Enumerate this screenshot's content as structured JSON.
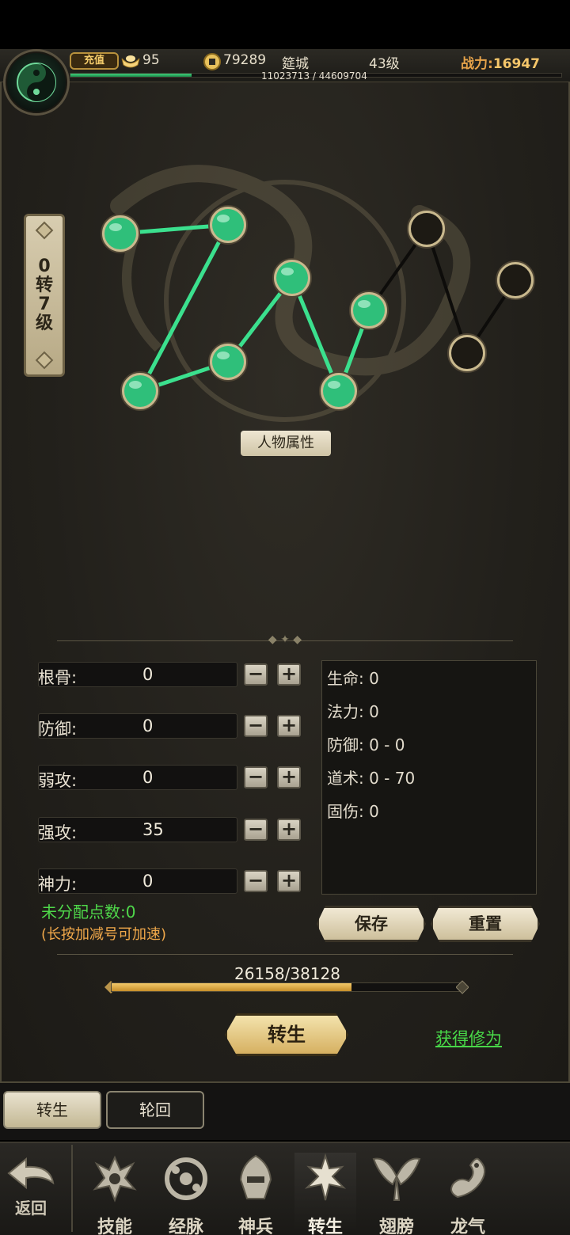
{
  "header": {
    "recharge_label": "充值",
    "ingots": "95",
    "coins": "79289",
    "location": "筵城",
    "level": "43级",
    "power_label": "战力:",
    "power_value": "16947",
    "xp_text": "11023713 / 44609704",
    "xp_fraction": 0.247
  },
  "rank": {
    "line1": "0",
    "line2": "转",
    "line3": "7",
    "line4": "级"
  },
  "constellation_title": "人物属性",
  "stats": [
    {
      "label": "根骨:",
      "value": "0"
    },
    {
      "label": "防御:",
      "value": "0"
    },
    {
      "label": "弱攻:",
      "value": "0"
    },
    {
      "label": "强攻:",
      "value": "35"
    },
    {
      "label": "神力:",
      "value": "0"
    }
  ],
  "results": [
    "生命: 0",
    "法力: 0",
    "防御: 0 - 0",
    "道术: 0 - 70",
    "固伤: 0"
  ],
  "unassigned": "未分配点数:0",
  "hint": "(长按加减号可加速)",
  "buttons": {
    "save": "保存",
    "reset": "重置",
    "rebirth": "转生",
    "get_cultivation": "获得修为"
  },
  "progress": {
    "text": "26158/38128",
    "fraction": 0.686
  },
  "subtabs": [
    "转生",
    "轮回"
  ],
  "nav": {
    "back": "返回",
    "items": [
      "技能",
      "经脉",
      "神兵",
      "转生",
      "翅膀",
      "龙气"
    ],
    "active": "转生"
  },
  "colors": {
    "active_node": "#2fbf7a",
    "inactive_node": "#1d1a14",
    "link_active": "#3be08e",
    "accent_gold": "#d6b061",
    "green_text": "#4fd84a",
    "orange_text": "#f0a84a"
  }
}
